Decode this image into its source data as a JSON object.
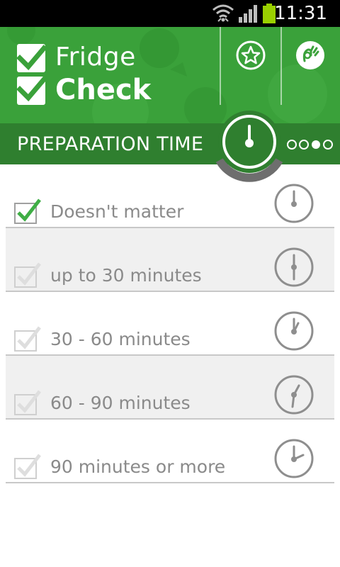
{
  "status_bar": {
    "time": "11:31"
  },
  "app": {
    "name_line1": "Fridge",
    "name_line2": "Check"
  },
  "header": {
    "favorites_icon": "star-circle-icon",
    "settings_icon": "hand-ok-icon",
    "section_title": "PREPARATION TIME",
    "page_indicator": {
      "total": 4,
      "active": 3
    }
  },
  "options": [
    {
      "label": "Doesn't matter",
      "checked": true,
      "clock_icon": "clock-neutral-icon"
    },
    {
      "label": "up to 30 minutes",
      "checked": false,
      "clock_icon": "clock-30-icon"
    },
    {
      "label": "30 - 60 minutes",
      "checked": false,
      "clock_icon": "clock-60-icon"
    },
    {
      "label": "60 - 90 minutes",
      "checked": false,
      "clock_icon": "clock-90-icon"
    },
    {
      "label": "90 minutes or more",
      "checked": false,
      "clock_icon": "clock-90plus-icon"
    }
  ],
  "colors": {
    "brand_green": "#3aa13a",
    "dark_green": "#2f7f2f",
    "check_green": "#3fae45",
    "text_gray": "#8a8a8a"
  }
}
